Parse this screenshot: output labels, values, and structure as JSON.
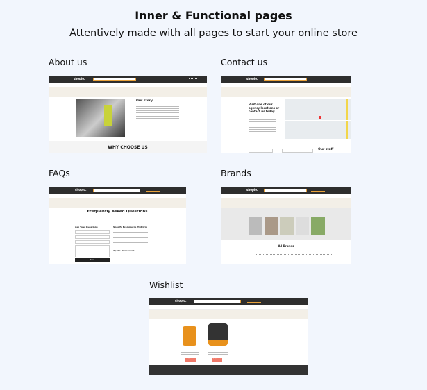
{
  "header": {
    "title": "Inner & Functional pages",
    "subtitle": "Attentively made with all pages to start your online store"
  },
  "brand": "shopio.",
  "sections": [
    {
      "label": "About us",
      "heading": "Our story",
      "footer_heading": "WHY CHOOSE US"
    },
    {
      "label": "Contact us",
      "heading": "Visit one of our agency locations or contact us today.",
      "side_heading": "Our staff"
    },
    {
      "label": "FAQs",
      "heading": "Frequently Asked Questions",
      "form_heading": "Ask Your Questions",
      "group1": "Shopify Ecommerce Platform",
      "group2": "Apollo Framework",
      "submit": "Send"
    },
    {
      "label": "Brands",
      "heading": "All Brands"
    },
    {
      "label": "Wishlist",
      "button": "Add to cart"
    }
  ],
  "colors": {
    "background": "#f2f6fd",
    "header_bar": "#2e2e2e",
    "accent": "#e9a23b",
    "breadcrumb_bg": "#f3efe7",
    "cart_button": "#f07a6a"
  }
}
